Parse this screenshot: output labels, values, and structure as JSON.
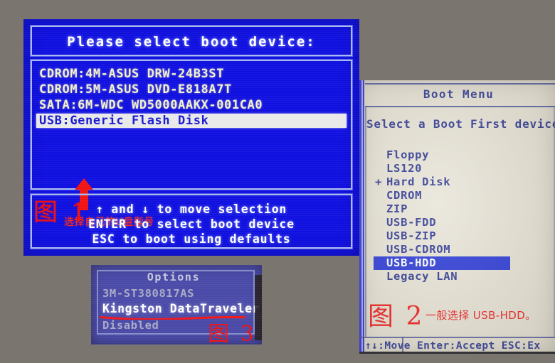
{
  "background_color": "#7a756f",
  "panel1": {
    "name": "boot-device-selection-screen",
    "bg_color": "#1010e0",
    "title": "Please select boot device:",
    "devices": [
      {
        "label": "CDROM:4M-ASUS DRW-24B3ST",
        "selected": false
      },
      {
        "label": "CDROM:5M-ASUS DVD-E818A7T",
        "selected": false
      },
      {
        "label": "SATA:6M-WDC WD5000AAKX-001CA0",
        "selected": false
      },
      {
        "label": "USB:Generic Flash Disk",
        "selected": true
      }
    ],
    "annotation_arrow": "red-up-arrow",
    "annotation_note": "选择自己的U盘型号",
    "help_lines": [
      "↑ and ↓ to move selection",
      "ENTER to select boot device",
      "ESC to boot using defaults"
    ],
    "figure_label": "图 1",
    "accent_color": "#ff2b16"
  },
  "panel2": {
    "name": "boot-menu-screen",
    "bg_color": "#e7e3d6",
    "title": "Boot Menu",
    "subtitle": "Select a Boot First device :",
    "devices": [
      {
        "marker": "",
        "label": "Floppy",
        "selected": false
      },
      {
        "marker": "",
        "label": "LS120",
        "selected": false
      },
      {
        "marker": "+",
        "label": "Hard Disk",
        "selected": false
      },
      {
        "marker": "",
        "label": "CDROM",
        "selected": false
      },
      {
        "marker": "",
        "label": "ZIP",
        "selected": false
      },
      {
        "marker": "",
        "label": "USB-FDD",
        "selected": false
      },
      {
        "marker": "",
        "label": "USB-ZIP",
        "selected": false
      },
      {
        "marker": "",
        "label": "USB-CDROM",
        "selected": false
      },
      {
        "marker": "",
        "label": "USB-HDD",
        "selected": true
      },
      {
        "marker": "",
        "label": "Legacy LAN",
        "selected": false
      }
    ],
    "figure_label": "图 2",
    "figure_note": "一般选择 USB-HDD。",
    "status_bar": "↑↓:Move  Enter:Accept  ESC:Ex",
    "text_color": "#25308f",
    "highlight_color": "#1f2fd6",
    "accent_color": "#ef1414"
  },
  "panel3": {
    "name": "options-popup",
    "bg_color": "#4a4aa8",
    "title": "Options",
    "rows": [
      {
        "label": "3M-ST380817AS",
        "state": "dim"
      },
      {
        "label": "Kingston DataTraveler",
        "state": "hot"
      },
      {
        "label": "Disabled",
        "state": "dim"
      }
    ],
    "strike_through": "red-wavy-underline",
    "figure_label": "图 3",
    "accent_color": "#f01212"
  }
}
